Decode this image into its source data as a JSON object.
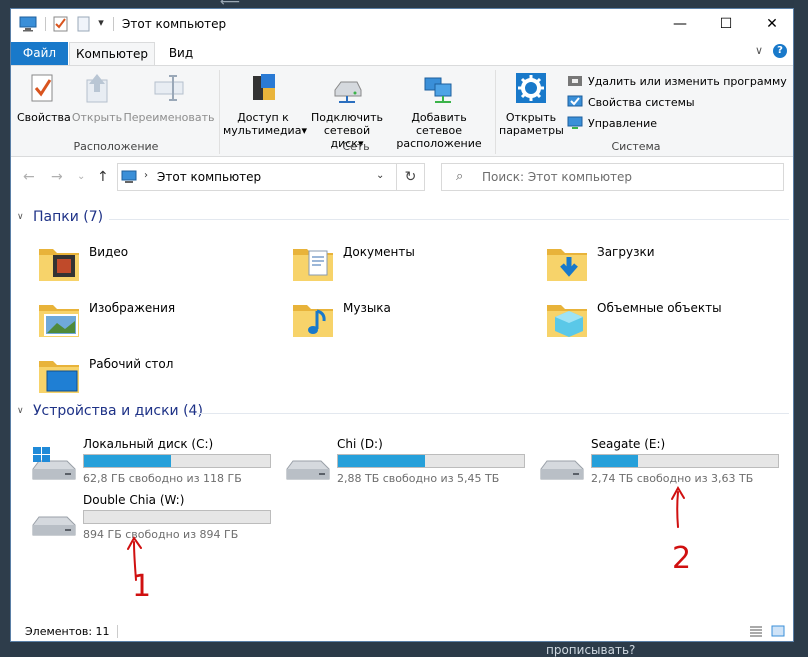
{
  "window": {
    "title": "Этот компьютер",
    "minimize": "—",
    "maximize": "☐",
    "close": "✕",
    "qa_dropdown": "▾"
  },
  "ribbon_tabs": {
    "file": "Файл",
    "computer": "Компьютер",
    "view": "Вид",
    "help": "?",
    "collapse": "∨"
  },
  "ribbon": {
    "location": {
      "label": "Расположение",
      "properties": "Свойства",
      "open": "Открыть",
      "rename": "Переименовать"
    },
    "network": {
      "label": "Сеть",
      "media_line1": "Доступ к",
      "media_line2": "мультимедиа",
      "map_line1": "Подключить",
      "map_line2": "сетевой диск",
      "add_line1": "Добавить сетевое",
      "add_line2": "расположение",
      "dd": "▾"
    },
    "system": {
      "label": "Система",
      "settings_line1": "Открыть",
      "settings_line2": "параметры",
      "uninstall": "Удалить или изменить программу",
      "sys_props": "Свойства системы",
      "manage": "Управление"
    }
  },
  "nav": {
    "back": "←",
    "forward": "→",
    "recent": "⌄",
    "up": "↑",
    "path": "Этот компьютер",
    "path_chevron": "›",
    "path_dropdown": "⌄",
    "refresh": "↻",
    "search_placeholder": "Поиск: Этот компьютер",
    "search_icon": "⌕"
  },
  "folders_section": {
    "title": "Папки (7)",
    "chevron": "∨",
    "items": [
      {
        "name": "Видео",
        "icon": "video-folder-icon"
      },
      {
        "name": "Документы",
        "icon": "documents-folder-icon"
      },
      {
        "name": "Загрузки",
        "icon": "downloads-folder-icon"
      },
      {
        "name": "Изображения",
        "icon": "pictures-folder-icon"
      },
      {
        "name": "Музыка",
        "icon": "music-folder-icon"
      },
      {
        "name": "Объемные объекты",
        "icon": "3d-objects-folder-icon"
      },
      {
        "name": "Рабочий стол",
        "icon": "desktop-folder-icon"
      }
    ]
  },
  "drives_section": {
    "title": "Устройства и диски (4)",
    "chevron": "∨",
    "items": [
      {
        "name": "Локальный диск (C:)",
        "free": "62,8 ГБ свободно из 118 ГБ",
        "used_fraction": 0.47,
        "system": true
      },
      {
        "name": "Chi (D:)",
        "free": "2,88 ТБ свободно из 5,45 ТБ",
        "used_fraction": 0.47,
        "system": false
      },
      {
        "name": "Seagate (E:)",
        "free": "2,74 ТБ свободно из 3,63 ТБ",
        "used_fraction": 0.245,
        "system": false
      },
      {
        "name": "Double Chia (W:)",
        "free": "894 ГБ свободно из 894 ГБ",
        "used_fraction": 0.0,
        "system": false
      }
    ]
  },
  "status": {
    "items": "Элементов: 11"
  },
  "annotations": {
    "label1": "1",
    "label2": "2",
    "color": "#d01010"
  },
  "background": {
    "bottom_text": "прописывать?"
  }
}
